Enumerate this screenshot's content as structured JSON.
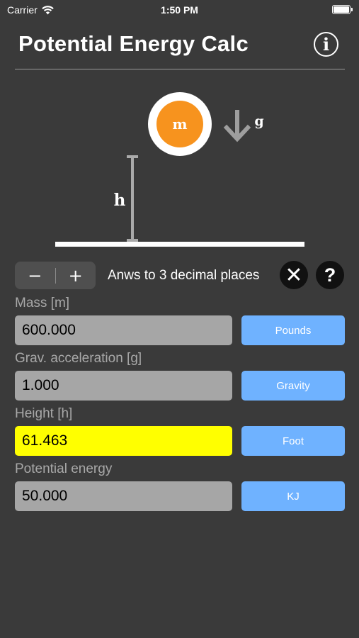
{
  "status_bar": {
    "carrier": "Carrier",
    "time": "1:50 PM",
    "wifi_icon": "wifi-icon",
    "battery_icon": "battery-icon"
  },
  "header": {
    "title": "Potential Energy Calc",
    "info_icon": "i"
  },
  "diagram": {
    "mass_symbol": "m",
    "gravity_symbol": "g",
    "height_symbol": "h",
    "colors": {
      "mass": "#f7931e",
      "line": "#ffffff",
      "arrow": "#9e9e9e"
    }
  },
  "precision": {
    "decrement_label": "−",
    "increment_label": "+",
    "label": "Anws to 3 decimal places",
    "clear_icon": "✕",
    "help_icon": "?"
  },
  "fields": {
    "mass": {
      "label": "Mass [m]",
      "value": "600.000",
      "unit": "Pounds"
    },
    "gravity": {
      "label": "Grav. acceleration [g]",
      "value": "1.000",
      "unit": "Gravity"
    },
    "height": {
      "label": "Height [h]",
      "value": "61.463",
      "unit": "Foot",
      "highlight_color": "#ffff00"
    },
    "energy": {
      "label": "Potential energy",
      "value": "50.000",
      "unit": "KJ"
    }
  },
  "colors": {
    "background": "#3a3a3a",
    "input_bg": "#a6a6a6",
    "unit_button": "#6fb2ff"
  }
}
